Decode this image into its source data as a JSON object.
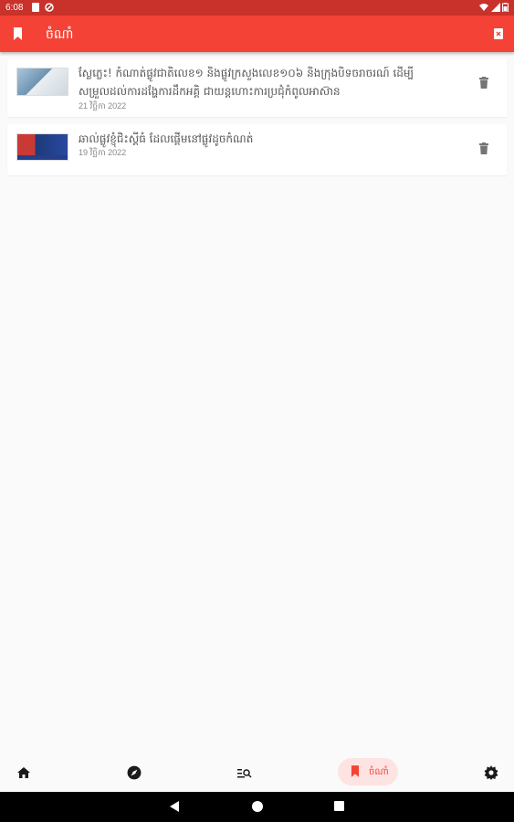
{
  "status_bar": {
    "time": "6:08"
  },
  "app_bar": {
    "title": "ចំណាំ"
  },
  "bookmarks": [
    {
      "title": "ស្លែភ្លេះ! កំណាត់ផ្លូវជាតិលេខ១ និងផ្លូវក្រសួងលេខ១០៦ និងក្រុងបិទចរាចរណ៍ ដើម្បីសម្រួលដល់ការដង្ហែការដឹកអគ្គិ ជាយន្តហោះការប្រជុំកំពូលអាស៊ាន",
      "date": "21 វិច្ឆិកា 2022"
    },
    {
      "title": "ឆាល់ផ្លូវខ្ញុំជិះស្គីធំ ដែលផ្ដើមនៅផ្លូវដូចកំណត់",
      "date": "19 វិច្ឆិកា 2022"
    }
  ],
  "bottom_nav": {
    "active_label": "ចំណាំ",
    "items": [
      "home-icon",
      "explore-icon",
      "search-list-icon",
      "bookmark-icon",
      "settings-icon"
    ]
  },
  "colors": {
    "primary": "#f44336",
    "status_bar": "#c8322b",
    "active_pill": "#fde4e3"
  }
}
